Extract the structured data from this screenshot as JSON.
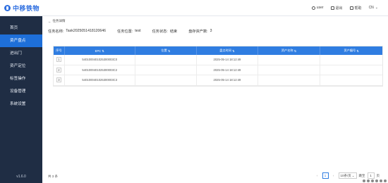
{
  "header": {
    "logo_text": "中移铁物",
    "user": "user",
    "logout": "退出",
    "help": "帮助",
    "lang": "CN"
  },
  "sidebar": {
    "items": [
      {
        "label": "首页",
        "active": false
      },
      {
        "label": "资产盘点",
        "active": true
      },
      {
        "label": "进出门",
        "active": false
      },
      {
        "label": "资产定位",
        "active": false
      },
      {
        "label": "标签操作",
        "active": false
      },
      {
        "label": "设备管理",
        "active": false
      },
      {
        "label": "系统设置",
        "active": false
      }
    ],
    "version": "v1.6.0"
  },
  "page": {
    "back_label": "任务详情",
    "info": {
      "task_name_label": "任务名称:",
      "task_name": "Task2025051418120646",
      "task_location_label": "任务位置:",
      "task_location": "test",
      "task_status_label": "任务状态:",
      "task_status": "结束",
      "unchecked_label": "盘存资产数:",
      "unchecked_value": "3"
    }
  },
  "table": {
    "columns": [
      "序号",
      "EPC",
      "位置",
      "盘点时间",
      "资产名称",
      "资产编号"
    ],
    "rows": [
      {
        "seq": "1",
        "epc": "5401000401025300003C0",
        "location": "",
        "time": "2025-05-14 18:12:49",
        "asset_name": "",
        "asset_no": ""
      },
      {
        "seq": "2",
        "epc": "5401000401025300003C2",
        "location": "",
        "time": "2025-05-14 18:12:49",
        "asset_name": "",
        "asset_no": ""
      },
      {
        "seq": "3",
        "epc": "5401000401025300003C3",
        "location": "",
        "time": "2025-05-14 18:12:49",
        "asset_name": "",
        "asset_no": ""
      }
    ]
  },
  "footer": {
    "total": "共 3 条"
  },
  "pagination": {
    "current_page": "1",
    "page_size": "10条/页",
    "jump_label": "跳至",
    "jump_value": "1",
    "page_unit": "页"
  }
}
